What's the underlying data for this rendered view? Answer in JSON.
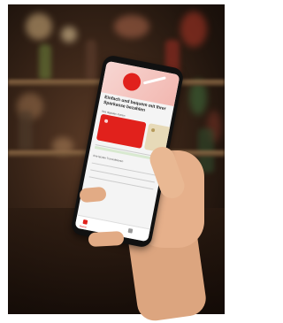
{
  "phone_screen": {
    "headline": "Einfach und bequem mit Ihrer Sparkasse bezahlen",
    "section_cards": "Ihre digitalen Karten",
    "section_transactions": "Ihre letzten Transaktionen",
    "nav_home": "Home"
  },
  "colors": {
    "brand_red": "#e1211c",
    "card_beige": "#e7dab8"
  }
}
